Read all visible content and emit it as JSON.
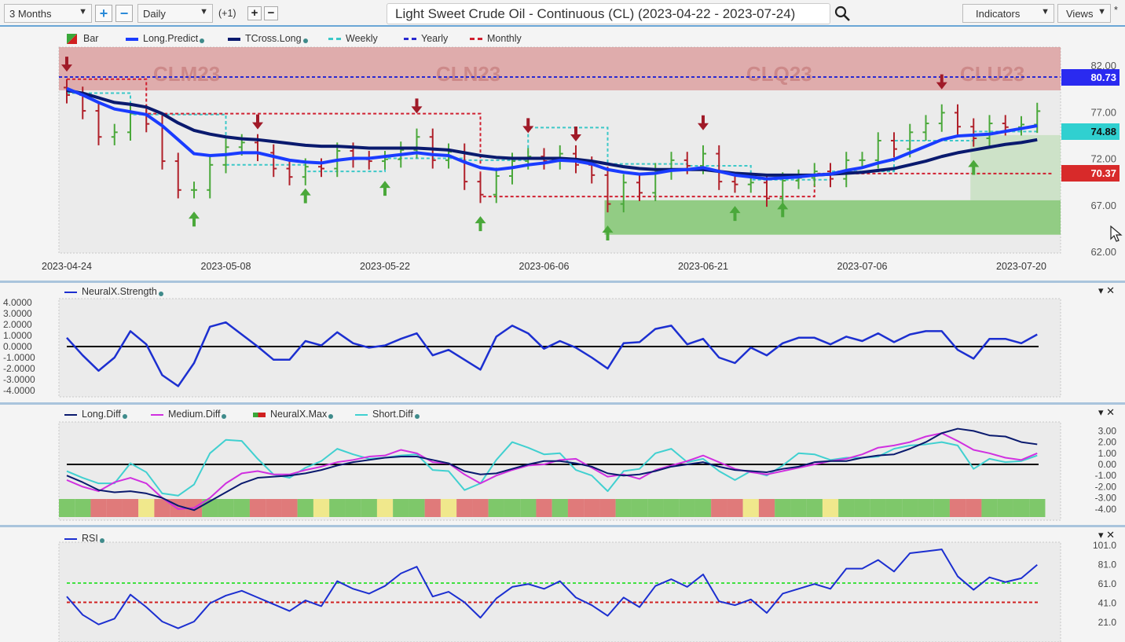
{
  "toolbar": {
    "range": "3 Months",
    "interval": "Daily",
    "offset": "(+1)",
    "title": "Light Sweet Crude Oil - Continuous (CL) (2023-04-22 - 2023-07-24)",
    "indicators": "Indicators",
    "views": "Views",
    "star": "*"
  },
  "main": {
    "legend": [
      {
        "label": "Bar"
      },
      {
        "label": "Long.Predict",
        "color": "#1a3cff"
      },
      {
        "label": "TCross.Long",
        "color": "#0a1a6e"
      },
      {
        "label": "Weekly",
        "color": "#3cc8c8"
      },
      {
        "label": "Yearly",
        "color": "#2a2ad0"
      },
      {
        "label": "Monthly",
        "color": "#d02030"
      }
    ],
    "contracts": [
      "CLM23",
      "CLN23",
      "CLQ23",
      "CLU23"
    ],
    "y_ticks": [
      "82.00",
      "77.00",
      "72.00",
      "67.00",
      "62.00"
    ],
    "price_tags": {
      "yearly": "80.73",
      "weekly": "74.88",
      "monthly": "70.37"
    },
    "x_ticks": [
      "2023-04-24",
      "2023-05-08",
      "2023-05-22",
      "2023-06-06",
      "2023-06-21",
      "2023-07-06",
      "2023-07-20"
    ]
  },
  "panels": {
    "strength": {
      "legend": "NeuralX.Strength",
      "ticks": [
        "4.0000",
        "3.0000",
        "2.0000",
        "1.0000",
        "0.0000",
        "-1.0000",
        "-2.0000",
        "-3.0000",
        "-4.0000"
      ]
    },
    "diff": {
      "legend": [
        "Long.Diff",
        "Medium.Diff",
        "NeuralX.Max",
        "Short.Diff"
      ],
      "ticks": [
        "3.00",
        "2.00",
        "1.00",
        "0.00",
        "-1.00",
        "-2.00",
        "-3.00",
        "-4.00"
      ]
    },
    "rsi": {
      "legend": "RSI",
      "ticks": [
        "101.0",
        "81.0",
        "61.0",
        "41.0",
        "21.0"
      ]
    }
  },
  "chart_data": {
    "type": "line",
    "x_tick_index": [
      0,
      10,
      20,
      30,
      40,
      50,
      60
    ],
    "price_axis": [
      62,
      82
    ],
    "close": [
      78.8,
      77.1,
      74.3,
      74.8,
      76.8,
      75.7,
      71.7,
      68.6,
      68.6,
      71.3,
      73.2,
      73.7,
      72.6,
      70.9,
      70.0,
      71.1,
      70.9,
      72.8,
      71.9,
      71.7,
      71.9,
      72.9,
      74.3,
      71.8,
      72.7,
      69.5,
      68.1,
      70.1,
      71.7,
      72.2,
      71.7,
      72.5,
      71.3,
      70.2,
      67.1,
      69.4,
      68.3,
      70.6,
      71.8,
      71.2,
      72.5,
      69.5,
      69.2,
      69.4,
      67.7,
      69.6,
      69.9,
      70.6,
      69.8,
      71.8,
      71.8,
      73.9,
      73.0,
      74.8,
      75.75,
      76.9,
      75.4,
      74.15,
      75.75,
      75.35,
      75.63,
      77.07
    ],
    "long_predict": [
      79.5,
      78.8,
      78.0,
      77.3,
      77.0,
      76.7,
      75.5,
      74.0,
      72.5,
      72.3,
      72.4,
      72.6,
      72.6,
      72.2,
      71.8,
      71.6,
      71.5,
      71.8,
      72.0,
      72.0,
      72.2,
      72.4,
      72.6,
      72.4,
      72.3,
      71.6,
      71.0,
      70.8,
      71.0,
      71.3,
      71.5,
      71.8,
      71.7,
      71.4,
      70.8,
      70.5,
      70.3,
      70.4,
      70.7,
      70.8,
      71.0,
      70.6,
      70.2,
      70.0,
      69.8,
      69.9,
      70.0,
      70.2,
      70.3,
      70.7,
      71.0,
      71.5,
      71.9,
      72.6,
      73.3,
      74.0,
      74.4,
      74.5,
      74.6,
      74.9,
      75.2,
      75.5
    ],
    "tcross_long": [
      79.3,
      79.0,
      78.5,
      78.0,
      77.8,
      77.5,
      76.8,
      75.8,
      75.0,
      74.6,
      74.3,
      74.1,
      74.0,
      73.8,
      73.6,
      73.4,
      73.3,
      73.3,
      73.2,
      73.1,
      73.1,
      73.1,
      73.1,
      73.0,
      72.9,
      72.6,
      72.3,
      72.1,
      72.0,
      72.0,
      72.0,
      72.0,
      71.9,
      71.7,
      71.4,
      71.1,
      70.9,
      70.8,
      70.8,
      70.8,
      70.8,
      70.6,
      70.4,
      70.3,
      70.2,
      70.2,
      70.2,
      70.2,
      70.3,
      70.4,
      70.5,
      70.7,
      70.9,
      71.3,
      71.7,
      72.2,
      72.6,
      72.9,
      73.2,
      73.5,
      73.7,
      74.0
    ],
    "weekly_levels": [
      {
        "from": 0,
        "to": 4,
        "v": 79.0
      },
      {
        "from": 4,
        "to": 10,
        "v": 76.7
      },
      {
        "from": 10,
        "to": 15,
        "v": 71.3
      },
      {
        "from": 15,
        "to": 20,
        "v": 70.6
      },
      {
        "from": 20,
        "to": 25,
        "v": 72.0
      },
      {
        "from": 25,
        "to": 29,
        "v": 71.8
      },
      {
        "from": 29,
        "to": 34,
        "v": 75.3
      },
      {
        "from": 34,
        "to": 39,
        "v": 71.4
      },
      {
        "from": 39,
        "to": 43,
        "v": 71.2
      },
      {
        "from": 43,
        "to": 48,
        "v": 69.7
      },
      {
        "from": 48,
        "to": 52,
        "v": 70.6
      },
      {
        "from": 52,
        "to": 57,
        "v": 73.9
      },
      {
        "from": 57,
        "to": 61,
        "v": 74.88
      }
    ],
    "monthly_levels": [
      {
        "from": 0,
        "to": 5,
        "v": 80.5
      },
      {
        "from": 5,
        "to": 26,
        "v": 76.8
      },
      {
        "from": 26,
        "to": 47,
        "v": 67.9
      },
      {
        "from": 47,
        "to": 62,
        "v": 70.37
      }
    ],
    "yearly_level": 80.73,
    "sell_signals": [
      0,
      12,
      22,
      29,
      32,
      40,
      55
    ],
    "buy_signals": [
      8,
      15,
      20,
      26,
      34,
      42,
      45,
      57
    ],
    "neuralx_strength": [
      0.8,
      -0.8,
      -2.2,
      -1.0,
      1.4,
      0.2,
      -2.6,
      -3.6,
      -1.5,
      1.8,
      2.2,
      1.1,
      0,
      -1.2,
      -1.2,
      0.5,
      0.1,
      1.3,
      0.3,
      -0.1,
      0.1,
      0.7,
      1.2,
      -0.8,
      -0.3,
      -1.2,
      -2.1,
      0.9,
      1.9,
      1.2,
      -0.2,
      0.5,
      -0.1,
      -1.0,
      -2.0,
      0.3,
      0.4,
      1.6,
      1.9,
      0.2,
      0.7,
      -1.0,
      -1.5,
      -0.1,
      -0.8,
      0.3,
      0.8,
      0.8,
      0.2,
      0.9,
      0.5,
      1.2,
      0.4,
      1.1,
      1.4,
      1.4,
      -0.3,
      -1.1,
      0.7,
      0.7,
      0.3,
      1.1
    ],
    "long_diff": [
      -1.0,
      -1.6,
      -2.3,
      -2.5,
      -2.4,
      -2.6,
      -3.0,
      -3.7,
      -4.1,
      -3.3,
      -2.5,
      -1.7,
      -1.2,
      -1.1,
      -1.0,
      -0.8,
      -0.5,
      -0.1,
      0.2,
      0.4,
      0.6,
      0.7,
      0.7,
      0.4,
      0.1,
      -0.6,
      -0.9,
      -0.8,
      -0.4,
      0,
      0.3,
      0.3,
      0.1,
      -0.2,
      -0.8,
      -1.0,
      -0.9,
      -0.6,
      -0.2,
      0,
      0.2,
      -0.2,
      -0.5,
      -0.6,
      -0.7,
      -0.4,
      -0.2,
      0.2,
      0.3,
      0.3,
      0.6,
      0.8,
      0.9,
      1.4,
      2.0,
      2.8,
      3.2,
      3.0,
      2.6,
      2.5,
      2.0,
      1.8
    ],
    "medium_diff": [
      -1.4,
      -2.0,
      -2.4,
      -1.6,
      -1.2,
      -1.7,
      -3.0,
      -4.0,
      -3.9,
      -3.0,
      -1.7,
      -0.8,
      -0.6,
      -0.9,
      -0.9,
      -0.5,
      -0.2,
      0.2,
      0.4,
      0.7,
      0.8,
      1.3,
      1.0,
      0.2,
      0.1,
      -0.9,
      -1.7,
      -1.0,
      -0.5,
      -0.1,
      0,
      0.4,
      0.5,
      -0.3,
      -1.1,
      -0.9,
      -1.3,
      -0.5,
      -0.1,
      0.3,
      0.8,
      0.2,
      -0.4,
      -0.7,
      -0.9,
      -0.6,
      -0.3,
      0,
      0.3,
      0.5,
      0.9,
      1.5,
      1.7,
      2.0,
      2.5,
      2.8,
      2.1,
      1.3,
      1.0,
      0.6,
      0.4,
      1.0
    ],
    "short_diff": [
      -0.6,
      -1.2,
      -1.7,
      -1.7,
      0.1,
      -0.7,
      -2.6,
      -2.8,
      -1.8,
      1.0,
      2.2,
      2.1,
      0.5,
      -0.9,
      -1.2,
      -0.3,
      0.3,
      1.4,
      0.9,
      0.5,
      0.6,
      0.8,
      0.9,
      -0.5,
      -0.6,
      -2.3,
      -1.7,
      0.4,
      2.0,
      1.5,
      0.9,
      1.0,
      -0.5,
      -1.0,
      -2.4,
      -0.6,
      -0.4,
      1.0,
      1.4,
      0.2,
      0.5,
      -0.6,
      -1.4,
      -0.6,
      -1.0,
      -0.1,
      1.0,
      0.9,
      0.4,
      0.6,
      0.6,
      0.7,
      1.4,
      1.7,
      1.8,
      2.0,
      1.7,
      -0.4,
      0.5,
      0.2,
      0.3,
      0.8
    ],
    "neuralx_max": [
      "g",
      "g",
      "r",
      "r",
      "r",
      "y",
      "r",
      "r",
      "r",
      "g",
      "g",
      "g",
      "r",
      "r",
      "r",
      "g",
      "y",
      "g",
      "g",
      "g",
      "y",
      "g",
      "g",
      "r",
      "y",
      "r",
      "r",
      "g",
      "g",
      "g",
      "r",
      "g",
      "r",
      "r",
      "r",
      "g",
      "g",
      "g",
      "g",
      "g",
      "g",
      "r",
      "r",
      "y",
      "r",
      "g",
      "g",
      "g",
      "y",
      "g",
      "g",
      "g",
      "g",
      "g",
      "g",
      "g",
      "r",
      "r",
      "g",
      "g",
      "g",
      "g"
    ],
    "rsi": [
      47,
      28,
      18,
      24,
      49,
      36,
      21,
      14,
      21,
      40,
      48,
      53,
      46,
      39,
      32,
      43,
      37,
      63,
      55,
      50,
      58,
      71,
      78,
      47,
      52,
      41,
      25,
      45,
      57,
      60,
      55,
      63,
      46,
      38,
      27,
      46,
      36,
      58,
      65,
      57,
      70,
      42,
      38,
      44,
      30,
      50,
      55,
      60,
      55,
      76,
      76,
      85,
      73,
      92,
      94,
      96,
      68,
      54,
      67,
      62,
      66,
      80
    ],
    "rsi_levels": [
      61,
      41
    ]
  },
  "colors": {
    "up": "#4aa83a",
    "down": "#b0202a",
    "long_predict": "#1a3cff",
    "tcross": "#0a1a6e",
    "weekly": "#3cc8c8",
    "yearly": "#2a2ad0",
    "monthly": "#d02030",
    "strength": "#1c2fd0",
    "medium": "#d030e0",
    "short": "#40d0d0",
    "green": "#7ec86a",
    "red": "#e07a7a",
    "yellow": "#f0e88c"
  }
}
